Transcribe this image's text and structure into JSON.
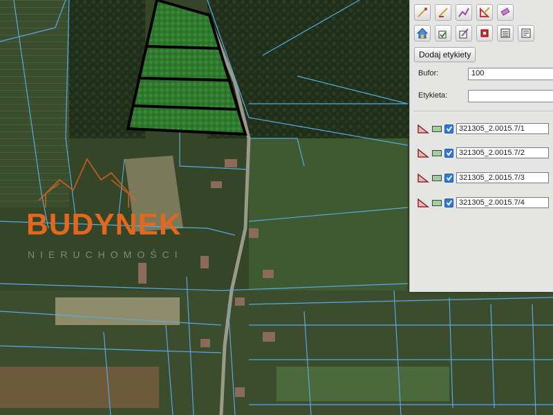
{
  "map": {
    "selected_parcels_outline": "#000000",
    "selected_parcels_fill": "#2f7a2f",
    "parcel_line_color": "#5aa9e6"
  },
  "watermark": {
    "title": "BUDYNEK",
    "subtitle": "NIERUCHOMOŚCI",
    "color": "#e2671f"
  },
  "panel": {
    "toolbar_row1": [
      {
        "icon": "draw-point-icon"
      },
      {
        "icon": "draw-line-icon"
      },
      {
        "icon": "draw-multiline-icon"
      },
      {
        "icon": "draw-polygon-icon"
      },
      {
        "icon": "eraser-icon"
      }
    ],
    "toolbar_row2": [
      {
        "icon": "home-icon"
      },
      {
        "icon": "select-edit-icon"
      },
      {
        "icon": "edit-shape-icon"
      },
      {
        "icon": "delete-shape-icon"
      },
      {
        "icon": "export-icon"
      },
      {
        "icon": "properties-icon"
      }
    ],
    "add_labels_button": "Dodaj etykiety",
    "buffer_label": "Bufor:",
    "buffer_value": "100",
    "label_label": "Etykieta:",
    "label_value": "",
    "layers": [
      {
        "name": "321305_2.0015.7/1",
        "checked": true
      },
      {
        "name": "321305_2.0015.7/2",
        "checked": true
      },
      {
        "name": "321305_2.0015.7/3",
        "checked": true
      },
      {
        "name": "321305_2.0015.7/4",
        "checked": true
      }
    ]
  }
}
